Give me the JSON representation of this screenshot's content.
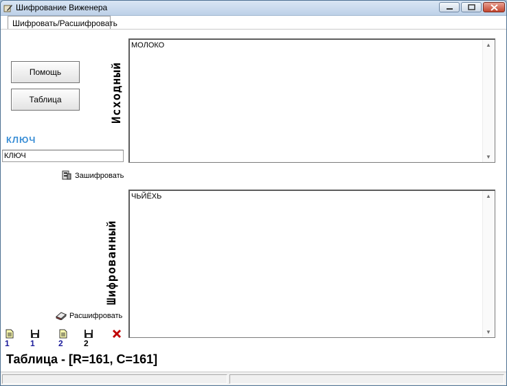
{
  "window": {
    "title": "Шифрование Виженера"
  },
  "tabs": [
    {
      "label": "Шифровать/Расшифровать"
    }
  ],
  "buttons": {
    "help": "Помощь",
    "table": "Таблица"
  },
  "source": {
    "label": "Исходный",
    "text": "МОЛОКО"
  },
  "key": {
    "label": "КЛЮЧ",
    "value": "КЛЮЧ"
  },
  "actions": {
    "encrypt": "Зашифровать",
    "decrypt": "Расшифровать"
  },
  "cipher": {
    "label": "Шифрованный",
    "text": "ЧЬЙЁХЬ"
  },
  "file_toolbar": {
    "open1": "1",
    "save1": "1",
    "open2": "2",
    "save2": "2"
  },
  "table_info": "Таблица - [R=161, C=161]",
  "icons": [
    "app-icon",
    "minimize-icon",
    "maximize-icon",
    "close-icon",
    "encrypt-icon",
    "decrypt-icon",
    "open-file-icon",
    "save-icon",
    "delete-icon"
  ],
  "colors": {
    "key_label": "#3b8fd6",
    "file_number": "#1a1a9a",
    "delete": "#c00000"
  }
}
